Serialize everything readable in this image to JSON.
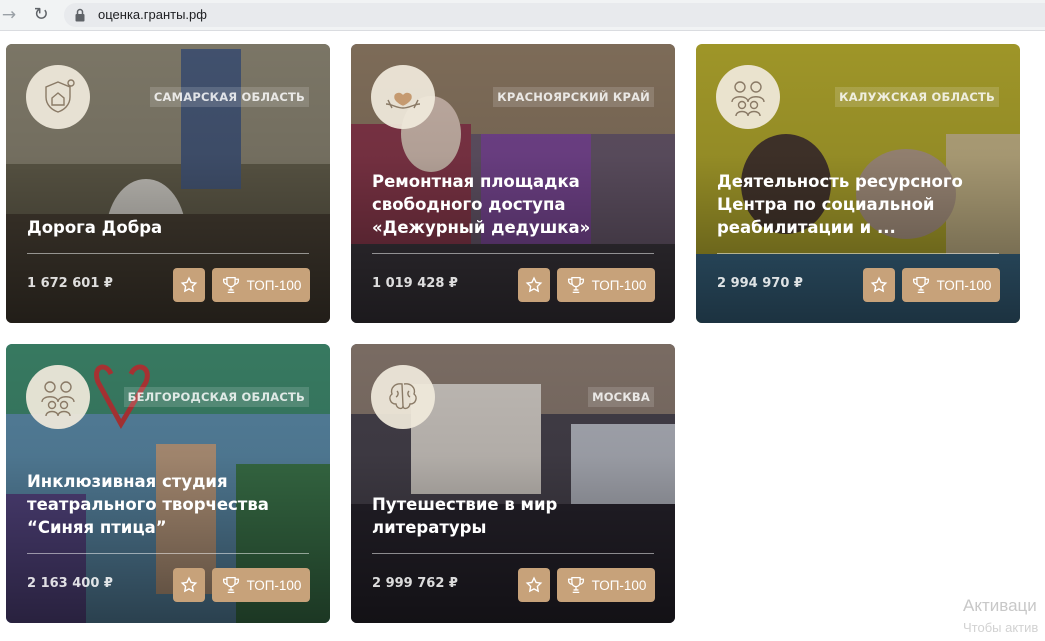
{
  "browser": {
    "url": "оценка.гранты.рф"
  },
  "projects": [
    {
      "region": "САМАРСКАЯ ОБЛАСТЬ",
      "title": "Дорога Добра",
      "amount": "1 672 601 ₽",
      "top_label": "ТОП-100",
      "icon": "shield-house-icon",
      "bg": "#6f6a5e",
      "accent": "#9a8f76"
    },
    {
      "region": "КРАСНОЯРСКИЙ КРАЙ",
      "title": "Ремонтная площадка свободного доступа «Дежурный дедушка»",
      "amount": "1 019 428 ₽",
      "top_label": "ТОП-100",
      "icon": "hands-heart-icon",
      "bg": "#6e5a78",
      "accent": "#a06f8e"
    },
    {
      "region": "КАЛУЖСКАЯ ОБЛАСТЬ",
      "title": "Деятельность ресурсного Центра по социальной реабилитации и ...",
      "amount": "2 994 970 ₽",
      "top_label": "ТОП-100",
      "icon": "family-icon",
      "bg": "#a9a02a",
      "accent": "#5f7f9a"
    },
    {
      "region": "БЕЛГОРОДСКАЯ ОБЛАСТЬ",
      "title": "Инклюзивная студия театрального творчества “Синяя птица”",
      "amount": "2 163 400 ₽",
      "top_label": "ТОП-100",
      "icon": "family-icon",
      "bg": "#5c8aa6",
      "accent": "#c76a4e"
    },
    {
      "region": "МОСКВА",
      "title": "Путешествие в мир литературы",
      "amount": "2 999 762 ₽",
      "top_label": "ТОП-100",
      "icon": "brain-icon",
      "bg": "#4a4550",
      "accent": "#6e5f58"
    }
  ],
  "watermark": {
    "line1": "Активаци",
    "line2": "Чтобы актив"
  }
}
